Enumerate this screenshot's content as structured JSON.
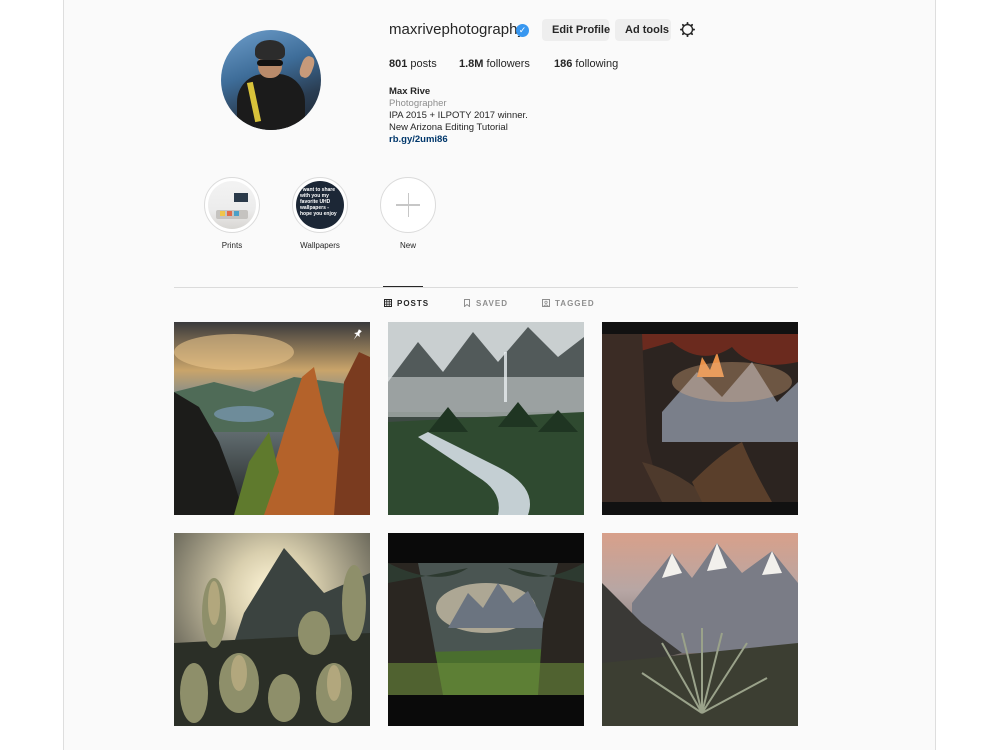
{
  "profile": {
    "username": "maxrivephotography",
    "verified_mark": "✓",
    "edit_profile_label": "Edit Profile",
    "ad_tools_label": "Ad tools",
    "settings_icon": "gear-icon",
    "stats": {
      "posts_count": "801",
      "posts_label": "posts",
      "followers_count": "1.8M",
      "followers_label": "followers",
      "following_count": "186",
      "following_label": "following"
    },
    "bio": {
      "name": "Max Rive",
      "category": "Photographer",
      "line1": "IPA 2015 + ILPOTY 2017 winner.",
      "line2": "New Arizona Editing Tutorial",
      "link": "rb.gy/2umi86"
    }
  },
  "highlights": [
    {
      "label": "Prints"
    },
    {
      "label": "Wallpapers",
      "cover_text": "I want to share with you my favorite UHD wallpapers - hope you enjoy"
    },
    {
      "label": "New"
    }
  ],
  "tabs": [
    {
      "label": "POSTS",
      "icon": "grid-icon",
      "active": true
    },
    {
      "label": "SAVED",
      "icon": "bookmark-icon",
      "active": false
    },
    {
      "label": "TAGGED",
      "icon": "tag-icon",
      "active": false
    }
  ],
  "posts": [
    {
      "subject": "mountain-peaks-sunset",
      "pinned": true
    },
    {
      "subject": "misty-valley-river",
      "pinned": false
    },
    {
      "subject": "tree-roots-fitz-roy",
      "pinned": false
    },
    {
      "subject": "cactus-sunburst",
      "pinned": false
    },
    {
      "subject": "forest-trees-mountains",
      "pinned": false
    },
    {
      "subject": "snowy-peaks-plant",
      "pinned": false
    }
  ],
  "colors": {
    "verified_blue": "#3897f0",
    "link_blue": "#00376b",
    "button_bg": "#eeeeee",
    "muted_text": "#8e8e8e",
    "border": "#dbdbdb"
  }
}
